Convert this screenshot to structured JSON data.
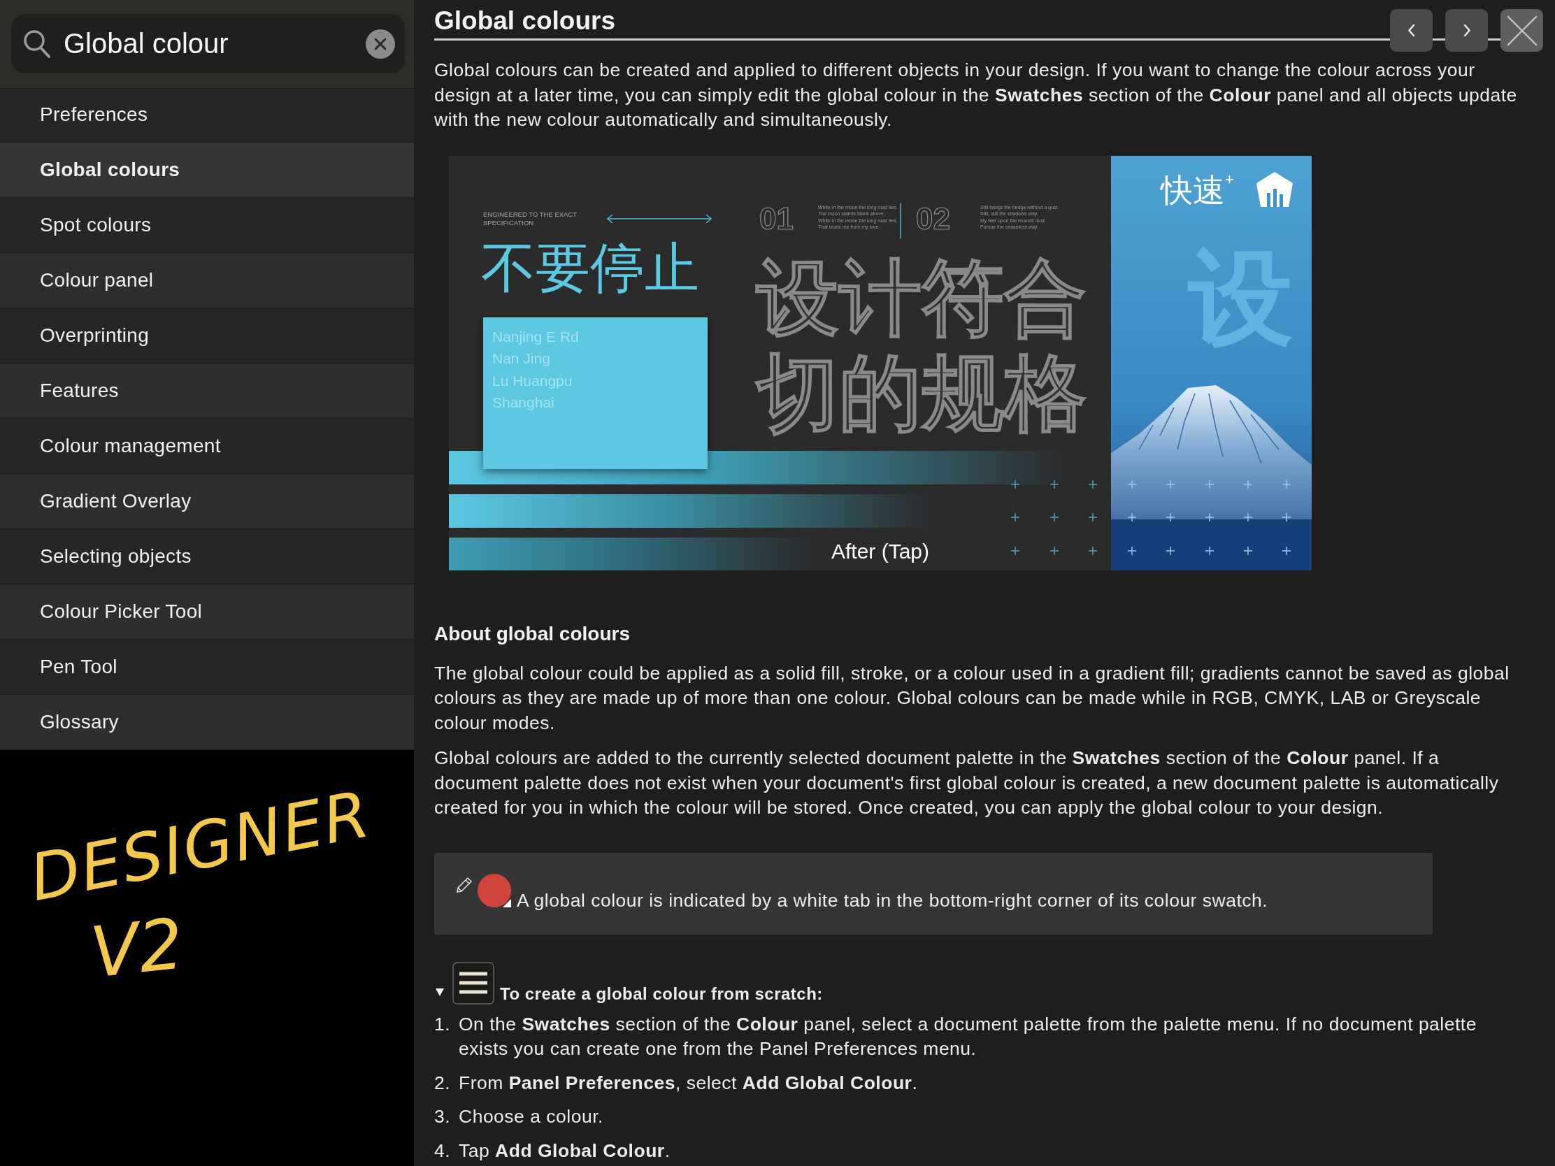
{
  "search": {
    "value": "Global colour"
  },
  "sidebar": {
    "items": [
      {
        "label": "Preferences",
        "selected": false
      },
      {
        "label": "Global colours",
        "selected": true
      },
      {
        "label": "Spot colours",
        "selected": false
      },
      {
        "label": "Colour panel",
        "selected": false
      },
      {
        "label": "Overprinting",
        "selected": false
      },
      {
        "label": "Features",
        "selected": false
      },
      {
        "label": "Colour management",
        "selected": false
      },
      {
        "label": "Gradient Overlay",
        "selected": false
      },
      {
        "label": "Selecting objects",
        "selected": false
      },
      {
        "label": "Colour Picker Tool",
        "selected": false
      },
      {
        "label": "Pen Tool",
        "selected": false
      },
      {
        "label": "Glossary",
        "selected": false
      }
    ]
  },
  "sketch": {
    "lines": [
      "DESIGNER",
      "V2"
    ]
  },
  "article": {
    "title": "Global colours",
    "intro": "Global colours can be created and applied to different objects in your design. If you want to change the colour across your design at a later time, you can simply edit the global colour in the **Swatches** section of the **Colour** panel and all objects update with the new colour automatically and simultaneously.",
    "figure": {
      "caption": "After (Tap)",
      "artwork": {
        "tagline": "ENGINEERED TO THE EXACT SPECIFICATION",
        "headline": "不要停止",
        "address": [
          "Nanjing E Rd",
          "Nan Jing",
          "Lu Huangpu",
          "Shanghai"
        ],
        "verses": [
          {
            "number": "01",
            "lines": [
              "White in the moon the long road lies.",
              "The moon stands blank above.",
              "White in the moon the long road lies.",
              "That leads me from my love."
            ]
          },
          {
            "number": "02",
            "lines": [
              "Still hangs the hedge without a gust.",
              "Still, still the shadows stay.",
              "My feet upon the moonlit dust.",
              "Pursue the ceaseless way."
            ]
          }
        ],
        "outline_lines": [
          "设计符合",
          "切的规格"
        ],
        "badge": "快速$^{+}$",
        "big_glyph": "设"
      }
    },
    "about": {
      "heading": "About global colours",
      "paragraphs": [
        "The global colour could be applied as a solid fill, stroke, or a colour used in a gradient fill; gradients cannot be saved as global colours as they are made up of more than one colour. Global colours can be made while in RGB, CMYK, LAB or Greyscale colour modes.",
        "Global colours are added to the currently selected document palette in the **Swatches** section of the **Colour** panel. If a document palette does not exist when your document's first global colour is created, a new document palette is automatically created for you in which the colour will be stored. Once created, you can apply the global colour to your design."
      ]
    },
    "note": {
      "text": "A global colour is indicated by a white tab in the bottom-right corner of its colour swatch."
    },
    "procedure": {
      "expanded": true,
      "title": "To create a global colour from scratch:",
      "steps": [
        {
          "number": "1.",
          "text": "On the **Swatches** section of the **Colour** panel, select a document palette from the palette menu. If no document palette exists you can create one from the Panel Preferences menu."
        },
        {
          "number": "2.",
          "text": "From **Panel Preferences**, select **Add Global Colour**."
        },
        {
          "number": "3.",
          "text": "Choose a colour."
        },
        {
          "number": "4.",
          "text": "Tap **Add Global Colour**."
        }
      ]
    }
  }
}
